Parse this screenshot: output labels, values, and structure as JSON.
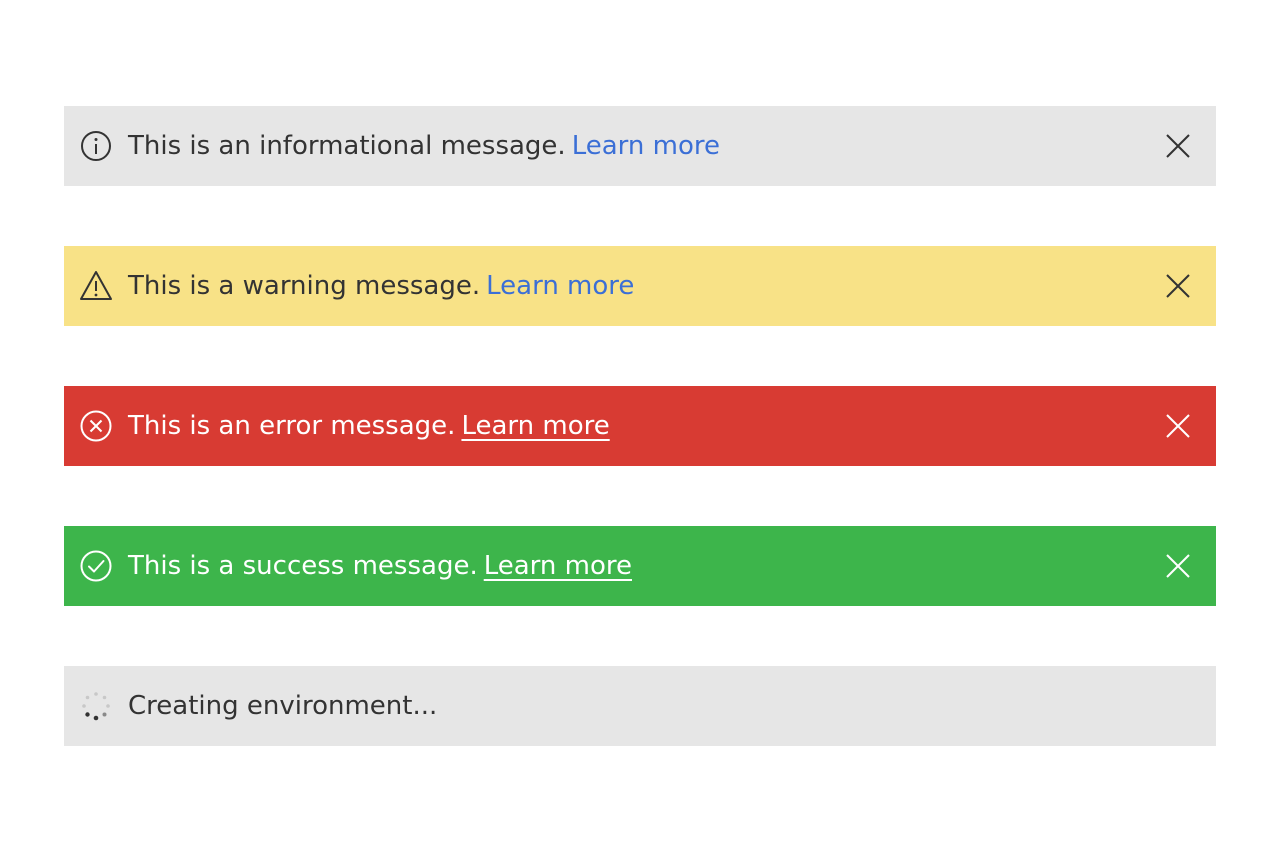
{
  "colors": {
    "info_bg": "#e6e6e6",
    "warning_bg": "#f8e287",
    "error_bg": "#d83b33",
    "success_bg": "#3db54b",
    "progress_bg": "#e6e6e6",
    "link": "#3b6fd6"
  },
  "bars": {
    "info": {
      "icon": "info-circle-icon",
      "text": "This is an informational message.",
      "link": "Learn more"
    },
    "warning": {
      "icon": "warning-triangle-icon",
      "text": "This is a warning message.",
      "link": "Learn more"
    },
    "error": {
      "icon": "error-circle-x-icon",
      "text": "This is an error message.",
      "link": "Learn more"
    },
    "success": {
      "icon": "success-check-circle-icon",
      "text": "This is a success message.",
      "link": "Learn more"
    },
    "progress": {
      "icon": "spinner-icon",
      "text": "Creating environment..."
    }
  }
}
